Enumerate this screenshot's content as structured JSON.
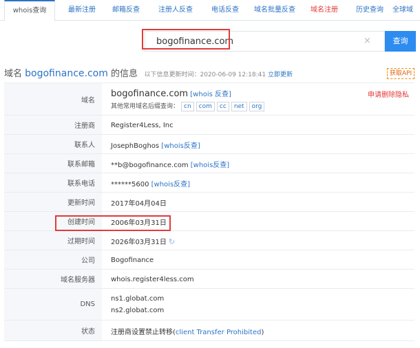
{
  "tabs": [
    {
      "label": "whois查询",
      "active": true,
      "red": false
    },
    {
      "label": "最新注册",
      "active": false,
      "red": false
    },
    {
      "label": "邮箱反查",
      "active": false,
      "red": false
    },
    {
      "label": "注册人反查",
      "active": false,
      "red": false
    },
    {
      "label": "电话反查",
      "active": false,
      "red": false
    },
    {
      "label": "域名批量反查",
      "active": false,
      "red": false
    },
    {
      "label": "域名注册",
      "active": false,
      "red": true
    },
    {
      "label": "历史查询",
      "active": false,
      "red": false
    },
    {
      "label": "全球域",
      "active": false,
      "red": false
    }
  ],
  "search": {
    "value": "bogofinance.com",
    "button_label": "查询",
    "clear_symbol": "×"
  },
  "info": {
    "title_prefix": "域名 ",
    "domain": "bogofinance.com",
    "title_suffix": " 的信息",
    "update_text": "以下信息更新时间：2020-06-09 12:18:41",
    "update_link": "立即更新",
    "api_label": "获取API"
  },
  "rows": {
    "domain": {
      "label": "域名",
      "value": "bogofinance.com",
      "reverse_link": "[whois 反查]",
      "privacy": "申请删除隐私",
      "suffix_label": "其他常用域名后缀查询：",
      "suffixes": [
        "cn",
        "com",
        "cc",
        "net",
        "org"
      ]
    },
    "registrar": {
      "label": "注册商",
      "value": "Register4Less, Inc"
    },
    "contact": {
      "label": "联系人",
      "value": "JosephBoghos",
      "reverse_link": "[whois反查]"
    },
    "email": {
      "label": "联系邮箱",
      "value": "**b@bogofinance.com",
      "reverse_link": "[whois反查]"
    },
    "phone": {
      "label": "联系电话",
      "value": "******5600",
      "reverse_link": "[whois反查]"
    },
    "updated": {
      "label": "更新时间",
      "value": "2017年04月04日"
    },
    "created": {
      "label": "创建时间",
      "value": "2006年03月31日"
    },
    "expires": {
      "label": "过期时间",
      "value": "2026年03月31日"
    },
    "company": {
      "label": "公司",
      "value": "Bogofinance"
    },
    "whois_server": {
      "label": "域名服务器",
      "value": "whois.register4less.com"
    },
    "dns": {
      "label": "DNS",
      "values": [
        "ns1.globat.com",
        "ns2.globat.com"
      ]
    },
    "status": {
      "label": "状态",
      "value": "注册商设置禁止转移(",
      "status_link": "client Transfer Prohibited",
      "close": ")"
    }
  },
  "colors": {
    "accent": "#2b73c5",
    "highlight": "#e23a3a",
    "button": "#2d8cf0"
  }
}
